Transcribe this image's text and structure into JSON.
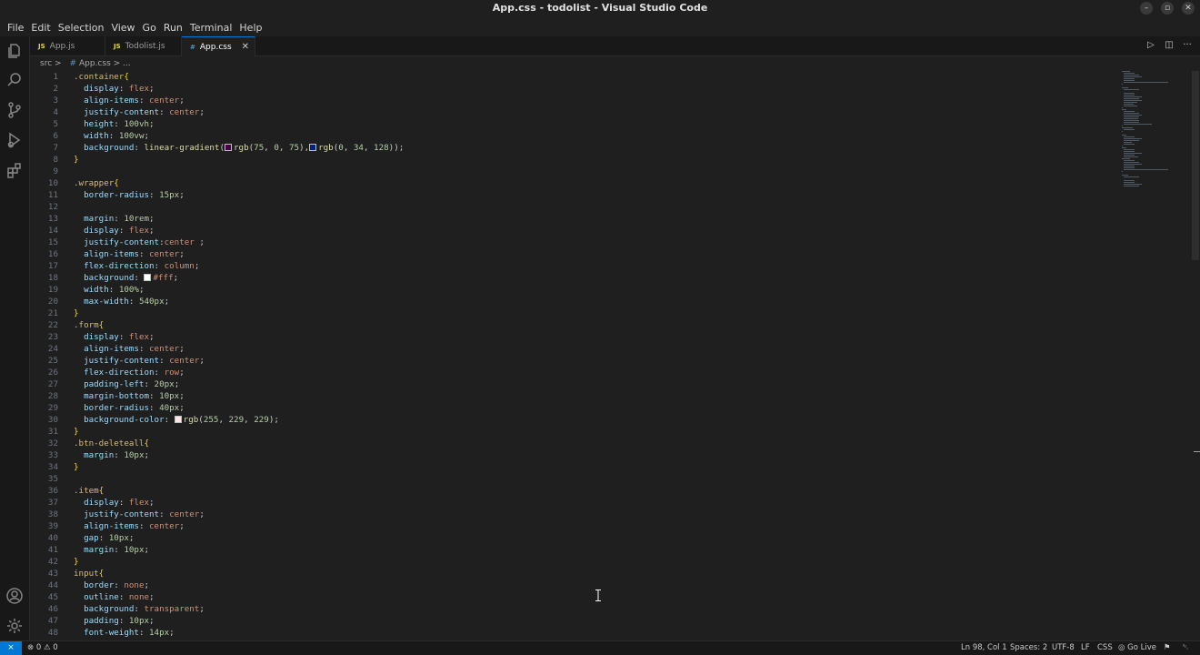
{
  "window": {
    "title": "App.css - todolist - Visual Studio Code",
    "minimize": "–",
    "restore": "▫",
    "close": "✕"
  },
  "menu": [
    "File",
    "Edit",
    "Selection",
    "View",
    "Go",
    "Run",
    "Terminal",
    "Help"
  ],
  "activity_icons": [
    "explorer-icon",
    "search-icon",
    "source-control-icon",
    "run-debug-icon",
    "extensions-icon",
    "account-icon",
    "settings-gear-icon"
  ],
  "tabs": [
    {
      "icon": "JS",
      "label": "App.js"
    },
    {
      "icon": "JS",
      "label": "Todolist.js"
    },
    {
      "icon": "#",
      "label": "App.css",
      "close": "✕"
    }
  ],
  "tab_actions": {
    "run": "▷",
    "split": "◫",
    "more": "···"
  },
  "breadcrumb": {
    "folder": "src",
    "sep": ">",
    "hash": "#",
    "file": "App.css",
    "tail": "> ..."
  },
  "code_lines": [
    ".container{",
    "  display: flex;",
    "  align-items: center;",
    "  justify-content: center;",
    "  height: 100vh;",
    "  width: 100vw;",
    "  background: linear-gradient(rgb(75, 0, 75),rgb(0, 34, 128));",
    "}",
    "",
    ".wrapper{",
    "  border-radius: 15px;",
    "",
    "  margin: 10rem;",
    "  display: flex;",
    "  justify-content:center ;",
    "  align-items: center;",
    "  flex-direction: column;",
    "  background: #fff;",
    "  width: 100%;",
    "  max-width: 540px;",
    "}",
    ".form{",
    "  display: flex;",
    "  align-items: center;",
    "  justify-content: center;",
    "  flex-direction: row;",
    "  padding-left: 20px;",
    "  margin-bottom: 10px;",
    "  border-radius: 40px;",
    "  background-color: rgb(255, 229, 229);",
    "}",
    ".btn-deleteall{",
    "  margin: 10px;",
    "}",
    "",
    ".item{",
    "  display: flex;",
    "  justify-content: center;",
    "  align-items: center;",
    "  gap: 10px;",
    "  margin: 10px;",
    "}",
    "input{",
    "  border: none;",
    "  outline: none;",
    "  background: transparent;",
    "  padding: 10px;",
    "  font-weight: 14px;"
  ],
  "swatch_colors": {
    "purple": "#4b004b",
    "navy": "#002280",
    "white": "#ffffff",
    "pink": "#ffe5e5"
  },
  "status": {
    "remote_icon": "remote-icon",
    "errors": "0",
    "warnings": "0",
    "position": "Ln 98, Col 1",
    "spaces": "Spaces: 2",
    "encoding": "UTF-8",
    "eol": "LF",
    "language": "CSS",
    "golive": "Go Live"
  },
  "colors": {
    "accent": "#0078d4",
    "selector": "#d7ba7d",
    "property": "#9cdcfe",
    "value": "#ce9178",
    "number": "#b5cea8",
    "brace": "#ffd700"
  }
}
